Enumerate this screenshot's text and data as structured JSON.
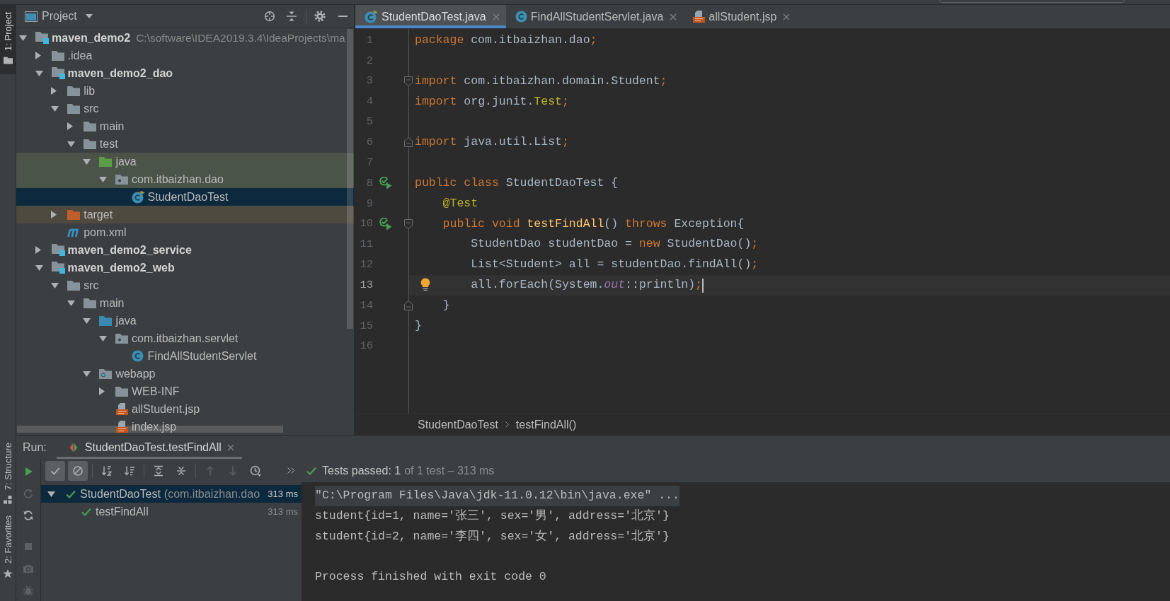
{
  "tool_window_bar": {
    "top_tabs": [
      {
        "label": "1: Project",
        "selected": true
      }
    ],
    "bottom_tabs": [
      {
        "label": "7: Structure",
        "selected": false
      },
      {
        "label": "2: Favorites",
        "selected": false
      }
    ]
  },
  "project_panel": {
    "title": "Project",
    "tree": [
      {
        "label": "maven_demo2",
        "path": "C:\\software\\IDEA2019.3.4\\IdeaProjects\\ma",
        "kind": "module",
        "expanded": true,
        "selected": false,
        "children": [
          {
            "label": ".idea",
            "kind": "folder",
            "expanded": false,
            "selected": false
          },
          {
            "label": "maven_demo2_dao",
            "kind": "module",
            "expanded": true,
            "selected": false,
            "children": [
              {
                "label": "lib",
                "kind": "folder",
                "expanded": false,
                "selected": false
              },
              {
                "label": "src",
                "kind": "folder",
                "expanded": true,
                "selected": false,
                "children": [
                  {
                    "label": "main",
                    "kind": "folder",
                    "expanded": false,
                    "selected": false
                  },
                  {
                    "label": "test",
                    "kind": "folder",
                    "expanded": true,
                    "selected": false,
                    "children": [
                      {
                        "label": "java",
                        "kind": "test_source",
                        "expanded": true,
                        "selected": false,
                        "children": [
                          {
                            "label": "com.itbaizhan.dao",
                            "kind": "test_package",
                            "expanded": true,
                            "selected": false,
                            "children": [
                              {
                                "label": "StudentDaoTest",
                                "kind": "test_class",
                                "selected": true
                              }
                            ]
                          }
                        ]
                      }
                    ]
                  }
                ]
              },
              {
                "label": "target",
                "kind": "excluded",
                "expanded": false,
                "selected": false
              },
              {
                "label": "pom.xml",
                "kind": "maven",
                "selected": false
              }
            ]
          },
          {
            "label": "maven_demo2_service",
            "kind": "module",
            "expanded": false,
            "selected": false
          },
          {
            "label": "maven_demo2_web",
            "kind": "module",
            "expanded": true,
            "selected": false,
            "children": [
              {
                "label": "src",
                "kind": "folder",
                "expanded": true,
                "selected": false,
                "children": [
                  {
                    "label": "main",
                    "kind": "folder",
                    "expanded": true,
                    "selected": false,
                    "children": [
                      {
                        "label": "java",
                        "kind": "source",
                        "expanded": true,
                        "selected": false,
                        "children": [
                          {
                            "label": "com.itbaizhan.servlet",
                            "kind": "package",
                            "expanded": true,
                            "selected": false,
                            "children": [
                              {
                                "label": "FindAllStudentServlet",
                                "kind": "class",
                                "selected": false
                              }
                            ]
                          }
                        ]
                      },
                      {
                        "label": "webapp",
                        "kind": "web",
                        "expanded": true,
                        "selected": false,
                        "children": [
                          {
                            "label": "WEB-INF",
                            "kind": "folder",
                            "expanded": false,
                            "selected": false
                          },
                          {
                            "label": "allStudent.jsp",
                            "kind": "jsp",
                            "selected": false
                          },
                          {
                            "label": "index.jsp",
                            "kind": "jsp",
                            "selected": false
                          }
                        ]
                      }
                    ]
                  }
                ]
              }
            ]
          }
        ]
      }
    ]
  },
  "editor": {
    "tabs": [
      {
        "label": "StudentDaoTest.java",
        "kind": "test_class",
        "selected": true
      },
      {
        "label": "FindAllStudentServlet.java",
        "kind": "class",
        "selected": false
      },
      {
        "label": "allStudent.jsp",
        "kind": "jsp",
        "selected": false
      }
    ],
    "lines": [
      {
        "number": "1",
        "current": false,
        "tokens": [
          {
            "text": "package",
            "kind": "keyword"
          },
          {
            "text": " com.itbaizhan.dao",
            "kind": "plain"
          },
          {
            "text": ";",
            "kind": "keyword"
          }
        ]
      },
      {
        "number": "2",
        "current": false
      },
      {
        "number": "3",
        "current": false,
        "gutter": [
          {
            "kind": "fold_start"
          }
        ],
        "tokens": [
          {
            "text": "import",
            "kind": "keyword"
          },
          {
            "text": " com.itbaizhan.domain.Student",
            "kind": "plain"
          },
          {
            "text": ";",
            "kind": "keyword"
          }
        ]
      },
      {
        "number": "4",
        "current": false,
        "tokens": [
          {
            "text": "import",
            "kind": "keyword"
          },
          {
            "text": " org.junit.",
            "kind": "plain"
          },
          {
            "text": "Test",
            "kind": "annotation"
          },
          {
            "text": ";",
            "kind": "keyword"
          }
        ]
      },
      {
        "number": "5",
        "current": false
      },
      {
        "number": "6",
        "current": false,
        "gutter": [
          {
            "kind": "fold_end"
          }
        ],
        "tokens": [
          {
            "text": "import",
            "kind": "keyword"
          },
          {
            "text": " java.util.List",
            "kind": "plain"
          },
          {
            "text": ";",
            "kind": "keyword"
          }
        ]
      },
      {
        "number": "7",
        "current": false
      },
      {
        "number": "8",
        "current": false,
        "gutter": [
          {
            "kind": "run"
          }
        ],
        "tokens": [
          {
            "text": "public class",
            "kind": "keyword"
          },
          {
            "text": " StudentDaoTest {",
            "kind": "plain"
          }
        ]
      },
      {
        "number": "9",
        "current": false,
        "tokens": [
          {
            "text": "    @Test",
            "kind": "annotation"
          }
        ]
      },
      {
        "number": "10",
        "current": false,
        "gutter": [
          {
            "kind": "run"
          },
          {
            "kind": "fold_start"
          }
        ],
        "tokens": [
          {
            "text": "    public void ",
            "kind": "keyword"
          },
          {
            "text": "testFindAll",
            "kind": "method"
          },
          {
            "text": "() ",
            "kind": "plain"
          },
          {
            "text": "throws",
            "kind": "keyword"
          },
          {
            "text": " Exception{",
            "kind": "plain"
          }
        ]
      },
      {
        "number": "11",
        "current": false,
        "tokens": [
          {
            "text": "        StudentDao studentDao = ",
            "kind": "plain"
          },
          {
            "text": "new",
            "kind": "keyword"
          },
          {
            "text": " StudentDao()",
            "kind": "plain"
          },
          {
            "text": ";",
            "kind": "keyword"
          }
        ]
      },
      {
        "number": "12",
        "current": false,
        "tokens": [
          {
            "text": "        List<Student> all = studentDao.findAll()",
            "kind": "plain"
          },
          {
            "text": ";",
            "kind": "keyword"
          }
        ]
      },
      {
        "number": "13",
        "current": true,
        "gutter": [
          {
            "kind": "bulb"
          }
        ],
        "tokens": [
          {
            "text": "        all.forEach(System.",
            "kind": "plain"
          },
          {
            "text": "out",
            "kind": "static_field"
          },
          {
            "text": "::println)",
            "kind": "plain"
          },
          {
            "text": ";",
            "kind": "keyword"
          }
        ]
      },
      {
        "number": "14",
        "current": false,
        "gutter": [
          {
            "kind": "fold_end"
          }
        ],
        "tokens": [
          {
            "text": "    }",
            "kind": "plain"
          }
        ]
      },
      {
        "number": "15",
        "current": false,
        "tokens": [
          {
            "text": "}",
            "kind": "plain"
          }
        ]
      },
      {
        "number": "16",
        "current": false
      }
    ],
    "breadcrumbs": [
      {
        "label": "StudentDaoTest"
      },
      {
        "label": "testFindAll()"
      }
    ]
  },
  "run_panel": {
    "label": "Run:",
    "tabs": [
      {
        "label": "StudentDaoTest.testFindAll",
        "selected": true
      }
    ],
    "side_toolbar": [
      {
        "disabled": false
      },
      {
        "disabled": true
      },
      {
        "disabled": false
      },
      {
        "disabled": true
      },
      {
        "disabled": true
      },
      {
        "disabled": true
      }
    ],
    "toolbar": [
      {
        "kind": "toggle",
        "on": true
      },
      {
        "kind": "toggle",
        "on": true
      },
      {
        "kind": "toggle",
        "on": false
      },
      {
        "kind": "toggle",
        "on": false
      },
      {
        "kind": "action",
        "disabled": false
      },
      {
        "kind": "action",
        "disabled": false
      },
      {
        "kind": "action",
        "disabled": true
      },
      {
        "kind": "action",
        "disabled": true
      },
      {
        "kind": "action",
        "disabled": false
      }
    ],
    "status": {
      "passed": true,
      "summary": "Tests passed: 1",
      "detail": "of 1 test – 313 ms"
    },
    "tests": [
      {
        "name": "StudentDaoTest",
        "detail": "(com.itbaizhan.dao",
        "time": "313 ms",
        "passed": true,
        "expanded": true,
        "selected": true,
        "children": [
          {
            "name": "testFindAll",
            "time": "313 ms",
            "passed": true,
            "selected": false
          }
        ]
      }
    ],
    "console": [
      {
        "kind": "command",
        "text": "\"C:\\Program Files\\Java\\jdk-11.0.12\\bin\\java.exe\" ..."
      },
      {
        "kind": "output",
        "text": "student{id=1, name='张三', sex='男', address='北京'}"
      },
      {
        "kind": "output",
        "text": "student{id=2, name='李四', sex='女', address='北京'}"
      },
      {
        "kind": "blank"
      },
      {
        "kind": "output",
        "text": "Process finished with exit code 0"
      }
    ]
  }
}
